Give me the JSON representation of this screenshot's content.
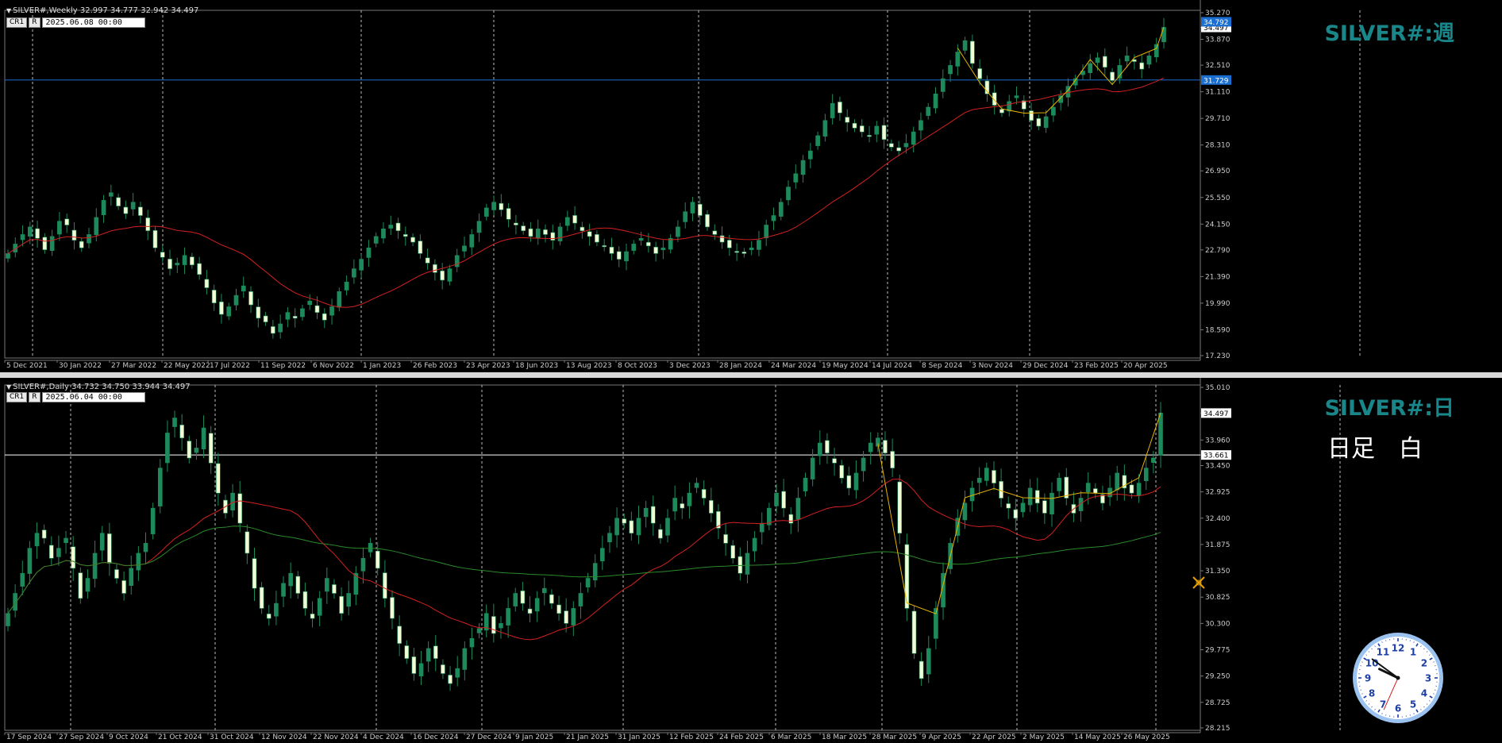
{
  "weekly": {
    "header": "SILVER#,Weekly  32.997 34.777 32.942 34.497",
    "chip_b1": "CR1",
    "chip_b2": "R",
    "chip_date": "2025.06.08 00:00",
    "label": "SILVER#:週",
    "price_labels": [
      "35.270",
      "34.497",
      "33.870",
      "32.510",
      "31.110",
      "29.710",
      "28.310",
      "26.950",
      "25.550",
      "24.150",
      "22.790",
      "21.390",
      "19.990",
      "18.590",
      "17.230"
    ],
    "badge_current": "34.792",
    "badge_current2": "34.497",
    "badge_line": "31.729",
    "date_labels": [
      "5 Dec 2021",
      "30 Jan 2022",
      "27 Mar 2022",
      "22 May 2022",
      "17 Jul 2022",
      "11 Sep 2022",
      "6 Nov 2022",
      "1 Jan 2023",
      "26 Feb 2023",
      "23 Apr 2023",
      "18 Jun 2023",
      "13 Aug 2023",
      "8 Oct 2023",
      "3 Dec 2023",
      "28 Jan 2024",
      "24 Mar 2024",
      "19 May 2024",
      "14 Jul 2024",
      "8 Sep 2024",
      "3 Nov 2024",
      "29 Dec 2024",
      "23 Feb 2025",
      "20 Apr 2025"
    ]
  },
  "daily": {
    "header": "SILVER#,Daily  34.732 34.750 33.944 34.497",
    "chip_b1": "CR1",
    "chip_b2": "R",
    "chip_date": "2025.06.04 00:00",
    "label": "SILVER#:日",
    "note": "日足　白",
    "price_labels": [
      "35.010",
      "34.497",
      "33.960",
      "33.661",
      "33.450",
      "32.925",
      "32.400",
      "31.875",
      "31.350",
      "30.825",
      "30.300",
      "29.775",
      "29.250",
      "28.725",
      "28.215"
    ],
    "badge_current": "34.497",
    "badge_line": "33.661",
    "date_labels": [
      "17 Sep 2024",
      "27 Sep 2024",
      "9 Oct 2024",
      "21 Oct 2024",
      "31 Oct 2024",
      "12 Nov 2024",
      "22 Nov 2024",
      "4 Dec 2024",
      "16 Dec 2024",
      "27 Dec 2024",
      "9 Jan 2025",
      "21 Jan 2025",
      "31 Jan 2025",
      "12 Feb 2025",
      "24 Feb 2025",
      "6 Mar 2025",
      "18 Mar 2025",
      "28 Mar 2025",
      "9 Apr 2025",
      "22 Apr 2025",
      "2 May 2025",
      "14 May 2025",
      "26 May 2025"
    ]
  },
  "clock": {
    "numbers": [
      "12",
      "1",
      "2",
      "3",
      "4",
      "5",
      "6",
      "7",
      "8",
      "9",
      "10",
      "11"
    ],
    "hour": 9.85,
    "minute": 51,
    "second": 34
  },
  "colors": {
    "bull": "#1d8a5b",
    "bear": "#f0ffd4",
    "ma_fast": "#d42020",
    "ma_slow": "#2a8a2a",
    "zigzag": "#e6b400",
    "hline_weekly": "#1a6fd0",
    "hline_daily": "#ffffff",
    "accent": "#19868a"
  },
  "chart_data": [
    {
      "type": "candlestick",
      "title": "SILVER#,Weekly",
      "ylim": [
        17.23,
        35.27
      ],
      "x_start": "5 Dec 2021",
      "x_end": "8 Jun 2025",
      "horizontal_line": 31.729,
      "close_last": 34.497,
      "series": [
        {
          "name": "close_approx",
          "values": [
            22.6,
            23.1,
            23.6,
            24.0,
            23.4,
            22.8,
            23.5,
            24.3,
            24.1,
            23.3,
            22.9,
            23.6,
            24.5,
            25.4,
            25.8,
            25.1,
            24.7,
            25.3,
            24.6,
            23.8,
            22.9,
            22.4,
            21.8,
            22.1,
            22.5,
            22.0,
            21.5,
            20.8,
            20.0,
            19.4,
            19.8,
            20.4,
            20.9,
            19.9,
            19.2,
            19.0,
            18.4,
            18.9,
            19.5,
            19.2,
            19.7,
            20.1,
            19.5,
            19.1,
            19.8,
            20.6,
            21.1,
            21.8,
            22.3,
            22.9,
            23.5,
            23.9,
            24.1,
            23.8,
            23.5,
            23.2,
            22.6,
            22.1,
            21.6,
            21.2,
            21.8,
            22.5,
            23.0,
            23.6,
            24.3,
            25.0,
            25.3,
            24.9,
            24.4,
            24.1,
            23.8,
            23.5,
            23.9,
            23.6,
            23.3,
            24.0,
            24.5,
            24.2,
            23.8,
            23.5,
            23.2,
            23.0,
            22.6,
            22.3,
            22.7,
            23.1,
            23.4,
            23.0,
            22.6,
            22.9,
            23.4,
            24.0,
            24.8,
            25.3,
            24.6,
            24.0,
            23.6,
            23.2,
            22.9,
            22.7,
            22.6,
            22.9,
            23.3,
            24.1,
            24.6,
            25.3,
            26.1,
            26.8,
            27.5,
            28.0,
            28.8,
            29.6,
            30.5,
            30.0,
            29.5,
            29.2,
            29.0,
            28.8,
            29.3,
            28.6,
            28.2,
            28.0,
            28.4,
            29.0,
            29.6,
            30.3,
            31.0,
            31.8,
            32.5,
            33.2,
            33.8,
            32.6,
            31.8,
            31.0,
            30.4,
            30.0,
            30.6,
            30.9,
            30.2,
            29.6,
            29.3,
            29.8,
            30.3,
            30.9,
            31.4,
            31.8,
            32.2,
            32.6,
            32.9,
            32.4,
            31.7,
            32.5,
            33.0,
            32.7,
            32.3,
            33.0,
            33.6,
            34.5
          ]
        }
      ]
    },
    {
      "type": "candlestick",
      "title": "SILVER#,Daily",
      "ylim": [
        28.215,
        35.01
      ],
      "x_start": "17 Sep 2024",
      "x_end": "4 Jun 2025",
      "horizontal_line": 33.661,
      "close_last": 34.497,
      "series": [
        {
          "name": "close_approx",
          "values": [
            30.5,
            30.9,
            31.3,
            31.8,
            32.1,
            32.0,
            31.6,
            31.8,
            32.0,
            31.4,
            30.8,
            31.2,
            31.7,
            32.1,
            31.5,
            31.2,
            30.9,
            31.4,
            31.7,
            31.9,
            32.6,
            33.4,
            34.1,
            34.4,
            34.0,
            33.6,
            33.8,
            34.2,
            33.5,
            32.9,
            32.5,
            32.9,
            32.3,
            31.7,
            31.0,
            30.6,
            30.4,
            30.7,
            31.1,
            31.3,
            30.9,
            30.6,
            30.4,
            30.8,
            31.2,
            30.9,
            30.5,
            30.9,
            31.3,
            31.6,
            31.9,
            31.4,
            30.8,
            30.4,
            29.9,
            29.6,
            29.3,
            29.5,
            29.8,
            29.6,
            29.3,
            29.1,
            29.4,
            29.8,
            30.0,
            30.2,
            30.5,
            30.1,
            30.3,
            30.6,
            30.9,
            30.7,
            30.5,
            30.8,
            31.0,
            30.7,
            30.5,
            30.3,
            30.6,
            30.9,
            31.2,
            31.5,
            31.8,
            32.1,
            32.4,
            32.3,
            32.1,
            32.4,
            32.6,
            32.3,
            32.0,
            32.4,
            32.8,
            32.6,
            32.9,
            33.1,
            32.8,
            32.5,
            32.2,
            31.9,
            31.6,
            31.3,
            31.7,
            32.0,
            32.3,
            32.6,
            32.9,
            32.6,
            32.3,
            32.8,
            33.2,
            33.6,
            33.9,
            33.7,
            33.5,
            33.2,
            33.0,
            33.3,
            33.6,
            33.9,
            34.0,
            33.7,
            33.4,
            32.1,
            30.6,
            29.7,
            29.2,
            29.8,
            30.6,
            31.3,
            31.9,
            32.4,
            32.7,
            33.0,
            33.2,
            33.4,
            33.1,
            32.8,
            32.6,
            32.4,
            32.7,
            33.0,
            32.7,
            32.5,
            32.9,
            33.2,
            32.8,
            32.5,
            32.8,
            33.1,
            32.9,
            32.7,
            33.0,
            33.3,
            33.0,
            32.9,
            33.1,
            33.4,
            33.6,
            34.5
          ]
        }
      ]
    }
  ]
}
